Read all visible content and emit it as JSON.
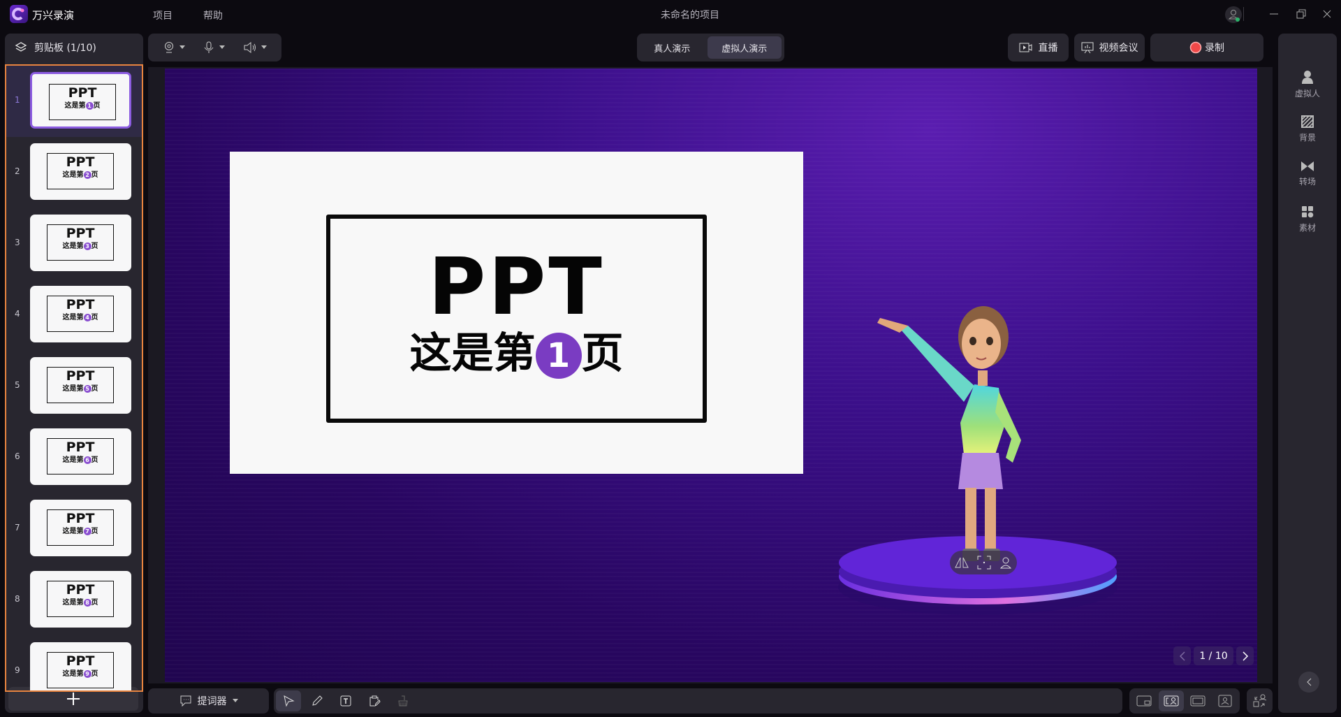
{
  "app": {
    "name": "万兴录演",
    "menus": [
      "项目",
      "帮助"
    ],
    "project_title": "未命名的项目"
  },
  "clipboard": {
    "title": "剪贴板 (1/10)",
    "selected": 1,
    "slides": [
      {
        "num": "1",
        "ppt": "PPT",
        "sub": "这是第",
        "circ": "1",
        "end": "页"
      },
      {
        "num": "2",
        "ppt": "PPT",
        "sub": "这是第",
        "circ": "2",
        "end": "页"
      },
      {
        "num": "3",
        "ppt": "PPT",
        "sub": "这是第",
        "circ": "3",
        "end": "页"
      },
      {
        "num": "4",
        "ppt": "PPT",
        "sub": "这是第",
        "circ": "4",
        "end": "页"
      },
      {
        "num": "5",
        "ppt": "PPT",
        "sub": "这是第",
        "circ": "5",
        "end": "页"
      },
      {
        "num": "6",
        "ppt": "PPT",
        "sub": "这是第",
        "circ": "6",
        "end": "页"
      },
      {
        "num": "7",
        "ppt": "PPT",
        "sub": "这是第",
        "circ": "7",
        "end": "页"
      },
      {
        "num": "8",
        "ppt": "PPT",
        "sub": "这是第",
        "circ": "8",
        "end": "页"
      },
      {
        "num": "9",
        "ppt": "PPT",
        "sub": "这是第",
        "circ": "9",
        "end": "页"
      }
    ]
  },
  "modes": {
    "live_person": "真人演示",
    "virtual_person": "虚拟人演示",
    "active": "virtual_person"
  },
  "actions": {
    "live": "直播",
    "meeting": "视频会议",
    "record": "录制"
  },
  "slide": {
    "title": "PPT",
    "sub": "这是第",
    "circ": "1",
    "end": "页"
  },
  "pager": {
    "current": 1,
    "total": 10,
    "label": "1 / 10"
  },
  "sidebar": {
    "items": [
      "虚拟人",
      "背景",
      "转场",
      "素材"
    ]
  },
  "bottom": {
    "teleprompter": "提词器"
  },
  "colors": {
    "accent": "#8b5ce0",
    "record": "#f04848",
    "selection_border": "#e8843f"
  }
}
